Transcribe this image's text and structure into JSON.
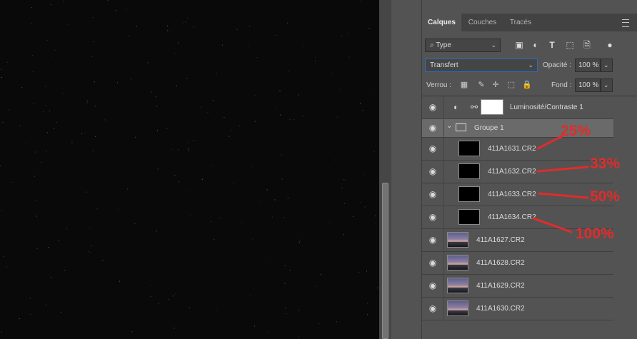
{
  "panel": {
    "tabs": [
      {
        "label": "Calques",
        "active": true
      },
      {
        "label": "Couches",
        "active": false
      },
      {
        "label": "Tracés",
        "active": false
      }
    ],
    "filter": {
      "label": "Type"
    },
    "blend_mode": "Transfert",
    "opacity": {
      "label": "Opacité :",
      "value": "100 %"
    },
    "lock": {
      "label": "Verrou :"
    },
    "fill": {
      "label": "Fond :",
      "value": "100 %"
    },
    "layers": [
      {
        "name": "Luminosité/Contraste 1",
        "kind": "adjustment"
      },
      {
        "name": "Groupe 1",
        "kind": "group"
      },
      {
        "name": "411A1631.CR2",
        "kind": "dark"
      },
      {
        "name": "411A1632.CR2",
        "kind": "dark"
      },
      {
        "name": "411A1633.CR2",
        "kind": "dark"
      },
      {
        "name": "411A1634.CR2",
        "kind": "dark"
      },
      {
        "name": "411A1627.CR2",
        "kind": "photo"
      },
      {
        "name": "411A1628.CR2",
        "kind": "photo"
      },
      {
        "name": "411A1629.CR2",
        "kind": "photo"
      },
      {
        "name": "411A1630.CR2",
        "kind": "photo"
      }
    ]
  },
  "annotations": [
    "25%",
    "33%",
    "50%",
    "100%"
  ],
  "colors": {
    "annotation": "#e32b2b",
    "canvas": "#0a0909",
    "panel": "#535353"
  }
}
